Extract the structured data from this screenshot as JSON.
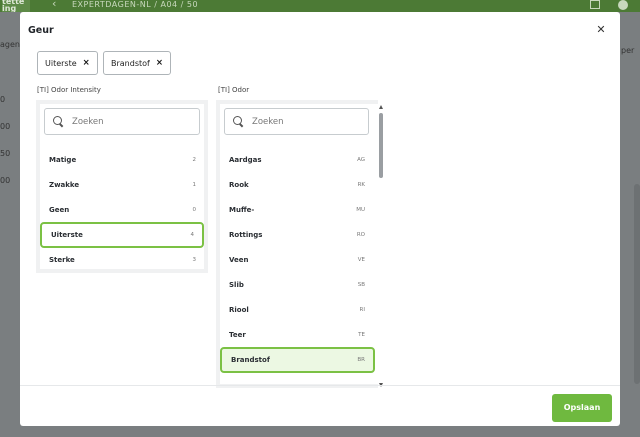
{
  "background": {
    "logo_text": "tette ing",
    "breadcrumb": "EXPERTDAGEN-NL  /  A04  /  50",
    "left_values": [
      "agen",
      "0",
      "00",
      "50",
      "00"
    ],
    "right_value": "per"
  },
  "modal": {
    "title": "Geur",
    "chips": [
      {
        "label": "Uiterste",
        "remove": "×"
      },
      {
        "label": "Brandstof",
        "remove": "×"
      }
    ],
    "intensity": {
      "label": "[TI] Odor Intensity",
      "search_placeholder": "Zoeken",
      "items": [
        {
          "label": "Matige",
          "code": "2"
        },
        {
          "label": "Zwakke",
          "code": "1"
        },
        {
          "label": "Geen",
          "code": "0"
        },
        {
          "label": "Uiterste",
          "code": "4",
          "selected": true
        },
        {
          "label": "Sterke",
          "code": "3"
        }
      ]
    },
    "odor": {
      "label": "[TI] Odor",
      "search_placeholder": "Zoeken",
      "items": [
        {
          "label": "Aardgas",
          "code": "AG"
        },
        {
          "label": "Rook",
          "code": "RK"
        },
        {
          "label": "Muffe-",
          "code": "MU"
        },
        {
          "label": "Rottings",
          "code": "RO"
        },
        {
          "label": "Veen",
          "code": "VE"
        },
        {
          "label": "Slib",
          "code": "SB"
        },
        {
          "label": "Riool",
          "code": "RI"
        },
        {
          "label": "Teer",
          "code": "TE"
        },
        {
          "label": "Brandstof",
          "code": "BR",
          "selected": true
        }
      ]
    },
    "save_label": "Opslaan",
    "colors": {
      "accent": "#6fb93f",
      "selected_border": "#7bc144",
      "selected_fill": "#ecf8e3"
    }
  }
}
